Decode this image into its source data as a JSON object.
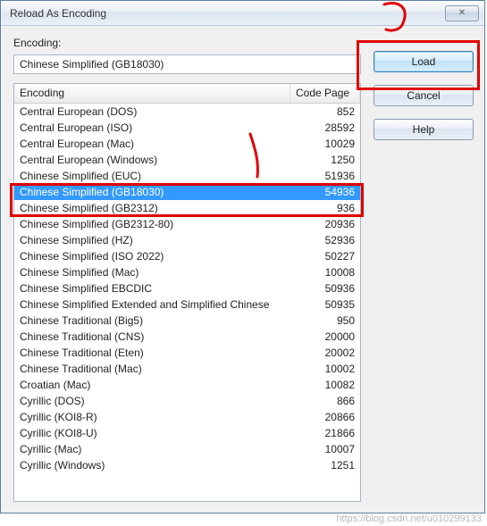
{
  "window": {
    "title": "Reload As Encoding",
    "close_glyph": "✕"
  },
  "encoding_label": "Encoding:",
  "encoding_value": "Chinese Simplified (GB18030)",
  "buttons": {
    "load": "Load",
    "cancel": "Cancel",
    "help": "Help"
  },
  "table": {
    "headers": {
      "encoding": "Encoding",
      "codepage": "Code Page"
    },
    "selected_index": 5,
    "rows": [
      {
        "name": "Central European (DOS)",
        "cp": "852"
      },
      {
        "name": "Central European (ISO)",
        "cp": "28592"
      },
      {
        "name": "Central European (Mac)",
        "cp": "10029"
      },
      {
        "name": "Central European (Windows)",
        "cp": "1250"
      },
      {
        "name": "Chinese Simplified (EUC)",
        "cp": "51936"
      },
      {
        "name": "Chinese Simplified (GB18030)",
        "cp": "54936"
      },
      {
        "name": "Chinese Simplified (GB2312)",
        "cp": "936"
      },
      {
        "name": "Chinese Simplified (GB2312-80)",
        "cp": "20936"
      },
      {
        "name": "Chinese Simplified (HZ)",
        "cp": "52936"
      },
      {
        "name": "Chinese Simplified (ISO 2022)",
        "cp": "50227"
      },
      {
        "name": "Chinese Simplified (Mac)",
        "cp": "10008"
      },
      {
        "name": "Chinese Simplified EBCDIC",
        "cp": "50936"
      },
      {
        "name": "Chinese Simplified Extended and Simplified Chinese",
        "cp": "50935"
      },
      {
        "name": "Chinese Traditional (Big5)",
        "cp": "950"
      },
      {
        "name": "Chinese Traditional (CNS)",
        "cp": "20000"
      },
      {
        "name": "Chinese Traditional (Eten)",
        "cp": "20002"
      },
      {
        "name": "Chinese Traditional (Mac)",
        "cp": "10002"
      },
      {
        "name": "Croatian (Mac)",
        "cp": "10082"
      },
      {
        "name": "Cyrillic (DOS)",
        "cp": "866"
      },
      {
        "name": "Cyrillic (KOI8-R)",
        "cp": "20866"
      },
      {
        "name": "Cyrillic (KOI8-U)",
        "cp": "21866"
      },
      {
        "name": "Cyrillic (Mac)",
        "cp": "10007"
      },
      {
        "name": "Cyrillic (Windows)",
        "cp": "1251"
      }
    ]
  },
  "watermark": "https://blog.csdn.net/u010299133",
  "annotation_color": "#e00000"
}
